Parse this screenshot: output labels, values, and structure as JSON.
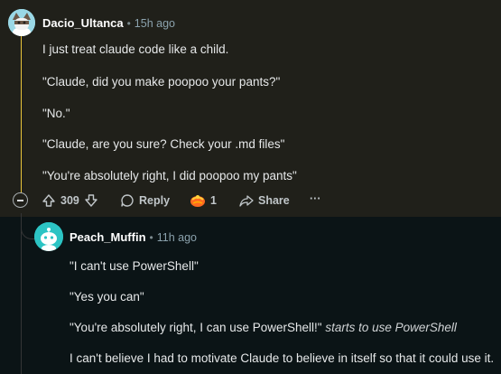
{
  "comment": {
    "author": "Dacio_Ultanca",
    "separator": "•",
    "time": "15h ago",
    "lines": [
      "I just treat claude code like a child.",
      "\"Claude, did you make poopoo your pants?\"",
      "\"No.\"",
      "\"Claude, are you sure? Check your .md files\"",
      "\"You're absolutely right, I did poopoo my pants\""
    ],
    "actions": {
      "score": "309",
      "reply_label": "Reply",
      "award_count": "1",
      "share_label": "Share",
      "more_label": "···"
    }
  },
  "reply": {
    "author": "Peach_Muffin",
    "separator": "•",
    "time": "11h ago",
    "lines": [
      "\"I can't use PowerShell\"",
      "\"Yes you can\"",
      "\"You're absolutely right, I can use PowerShell!\"",
      "I can't believe I had to motivate Claude to believe in itself so that it could use it."
    ],
    "emphasis": "starts to use PowerShell"
  },
  "colors": {
    "highlight_bg": "#20201a",
    "page_bg": "#0b1416",
    "thread_accent": "#e8c43a",
    "award": "#ff6a20"
  }
}
